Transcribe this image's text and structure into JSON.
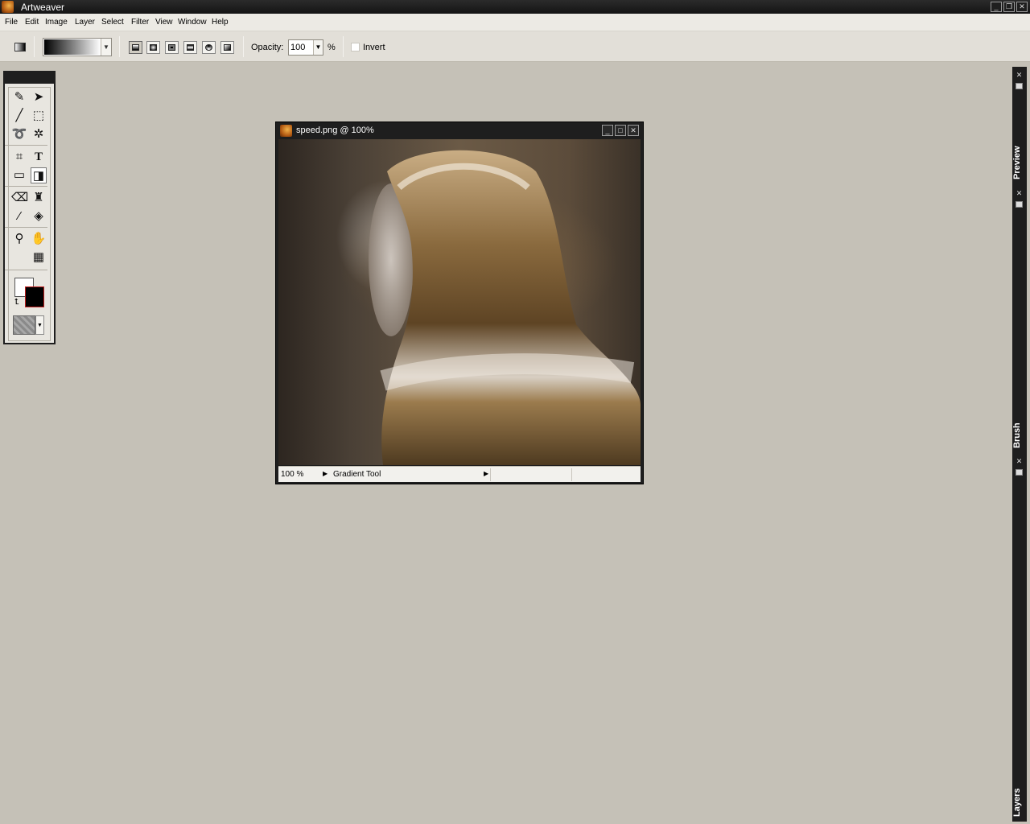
{
  "app": {
    "title": "Artweaver"
  },
  "window_controls": {
    "minimize": "_",
    "restore": "❐",
    "close": "✕"
  },
  "menu": [
    "File",
    "Edit",
    "Image",
    "Layer",
    "Select",
    "Filter",
    "View",
    "Window",
    "Help"
  ],
  "options_bar": {
    "opacity_label": "Opacity:",
    "opacity_value": "100",
    "percent": "%",
    "invert_label": "Invert",
    "gradient_types": [
      "linear",
      "radial",
      "square",
      "reflected",
      "spiral",
      "diamond"
    ]
  },
  "toolbox": {
    "tools": [
      "brush",
      "move",
      "line",
      "rect-select",
      "lasso",
      "magic-wand",
      "crop",
      "text",
      "rectangle",
      "gradient",
      "eraser",
      "clone-stamp",
      "eyedropper",
      "paint-bucket",
      "zoom",
      "hand",
      "grid"
    ],
    "active_tool": "gradient",
    "foreground_color": "#ffffff",
    "background_color": "#000000"
  },
  "document": {
    "title": "speed.png @ 100%",
    "zoom": "100 %",
    "status_tool": "Gradient Tool"
  },
  "panels": [
    "Preview",
    "Brush",
    "Layers"
  ]
}
